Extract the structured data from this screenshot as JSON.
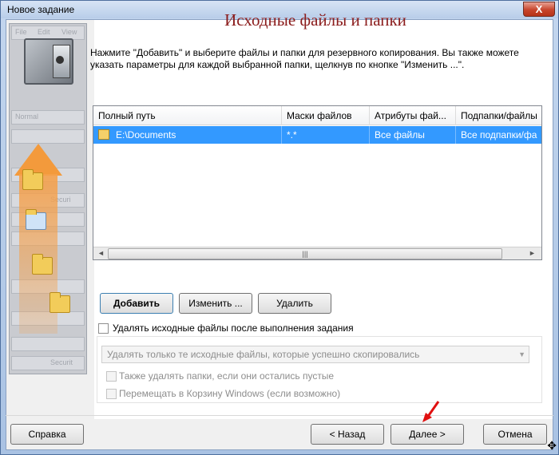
{
  "window": {
    "title": "Новое задание",
    "close_glyph": "X"
  },
  "sidebar": {
    "ghost_texts": [
      "File",
      "Edit",
      "View",
      "Normal",
      "Securi",
      "Securit"
    ]
  },
  "page": {
    "heading": "Исходные файлы и папки",
    "description": "Нажмите \"Добавить\" и выберите файлы и папки для резервного копирования. Вы также можете указать параметры для каждой выбранной папки, щелкнув по кнопке \"Изменить ...\"."
  },
  "list": {
    "columns": [
      "Полный путь",
      "Маски файлов",
      "Атрибуты фай...",
      "Подпапки/файлы"
    ],
    "rows": [
      {
        "path": "E:\\Documents",
        "mask": "*.*",
        "attributes": "Все файлы",
        "subfolders": "Все подпапки/фа"
      }
    ],
    "scroll_left": "◄",
    "scroll_right": "►",
    "scroll_grip": "|||"
  },
  "buttons": {
    "add": "Добавить",
    "edit": "Изменить ...",
    "delete": "Удалить"
  },
  "options": {
    "delete_source": "Удалять исходные файлы после выполнения задания",
    "delete_mode": "Удалять только те исходные файлы, которые успешно скопировались",
    "delete_empty_folders": "Также удалять папки, если они остались пустые",
    "move_to_recycle": "Перемещать в Корзину Windows (если возможно)"
  },
  "footer": {
    "help": "Справка",
    "back": "< Назад",
    "next": "Далее >",
    "cancel": "Отмена"
  },
  "colors": {
    "accent_heading": "#8b1c1c",
    "selection": "#3399ff",
    "pointer_arrow": "#e01010"
  }
}
